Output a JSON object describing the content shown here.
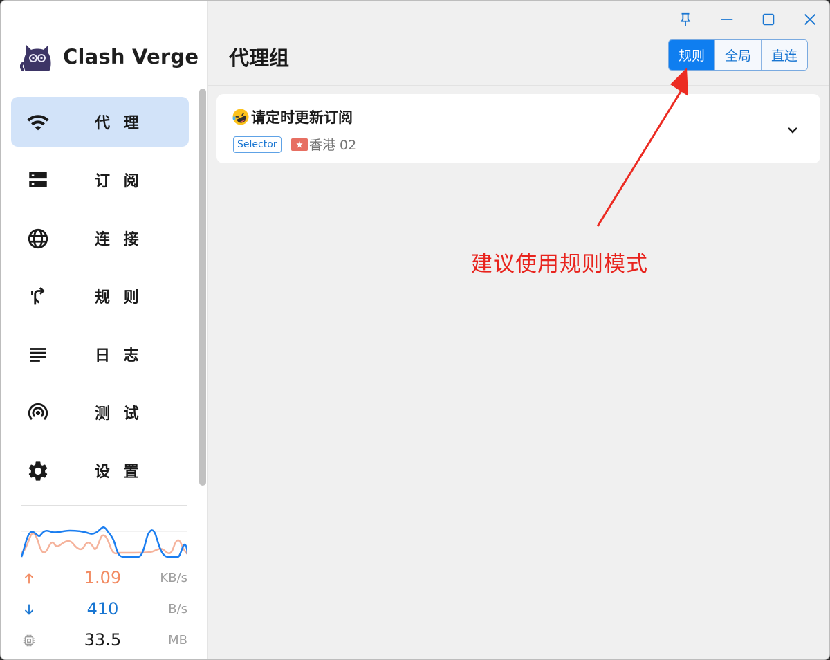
{
  "app": {
    "name": "Clash Verge"
  },
  "sidebar": {
    "items": [
      {
        "label": "代 理",
        "icon": "wifi-icon",
        "active": true
      },
      {
        "label": "订 阅",
        "icon": "storage-icon",
        "active": false
      },
      {
        "label": "连 接",
        "icon": "globe-icon",
        "active": false
      },
      {
        "label": "规 则",
        "icon": "fork-arrow-icon",
        "active": false
      },
      {
        "label": "日 志",
        "icon": "subject-icon",
        "active": false
      },
      {
        "label": "测 试",
        "icon": "broadcast-icon",
        "active": false
      },
      {
        "label": "设 置",
        "icon": "gear-icon",
        "active": false
      }
    ]
  },
  "traffic": {
    "upload": {
      "value": "1.09",
      "unit": "KB/s",
      "color": "#f28b62"
    },
    "download": {
      "value": "410",
      "unit": "B/s",
      "color": "#1976d2"
    },
    "memory": {
      "value": "33.5",
      "unit": "MB"
    }
  },
  "header": {
    "title": "代理组",
    "modes": [
      {
        "label": "规则",
        "active": true
      },
      {
        "label": "全局",
        "active": false
      },
      {
        "label": "直连",
        "active": false
      }
    ]
  },
  "proxy_groups": [
    {
      "name": "请定时更新订阅",
      "type": "Selector",
      "now": "香港 02"
    }
  ],
  "annotation": {
    "text": "建议使用规则模式",
    "color": "#e8231d"
  },
  "colors": {
    "accent": "#0f7ef0",
    "active_nav": "#d2e3f9"
  }
}
